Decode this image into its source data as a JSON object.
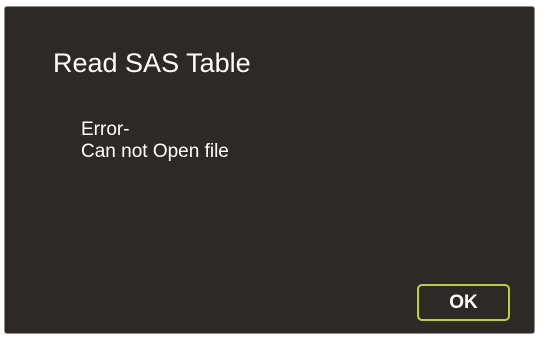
{
  "dialog": {
    "title": "Read SAS Table",
    "message_lines": [
      "Error-",
      "Can not Open file"
    ],
    "ok_label": "OK"
  },
  "colors": {
    "background": "#2d2926",
    "text": "#ffffff",
    "accent_border": "#b8d433"
  }
}
